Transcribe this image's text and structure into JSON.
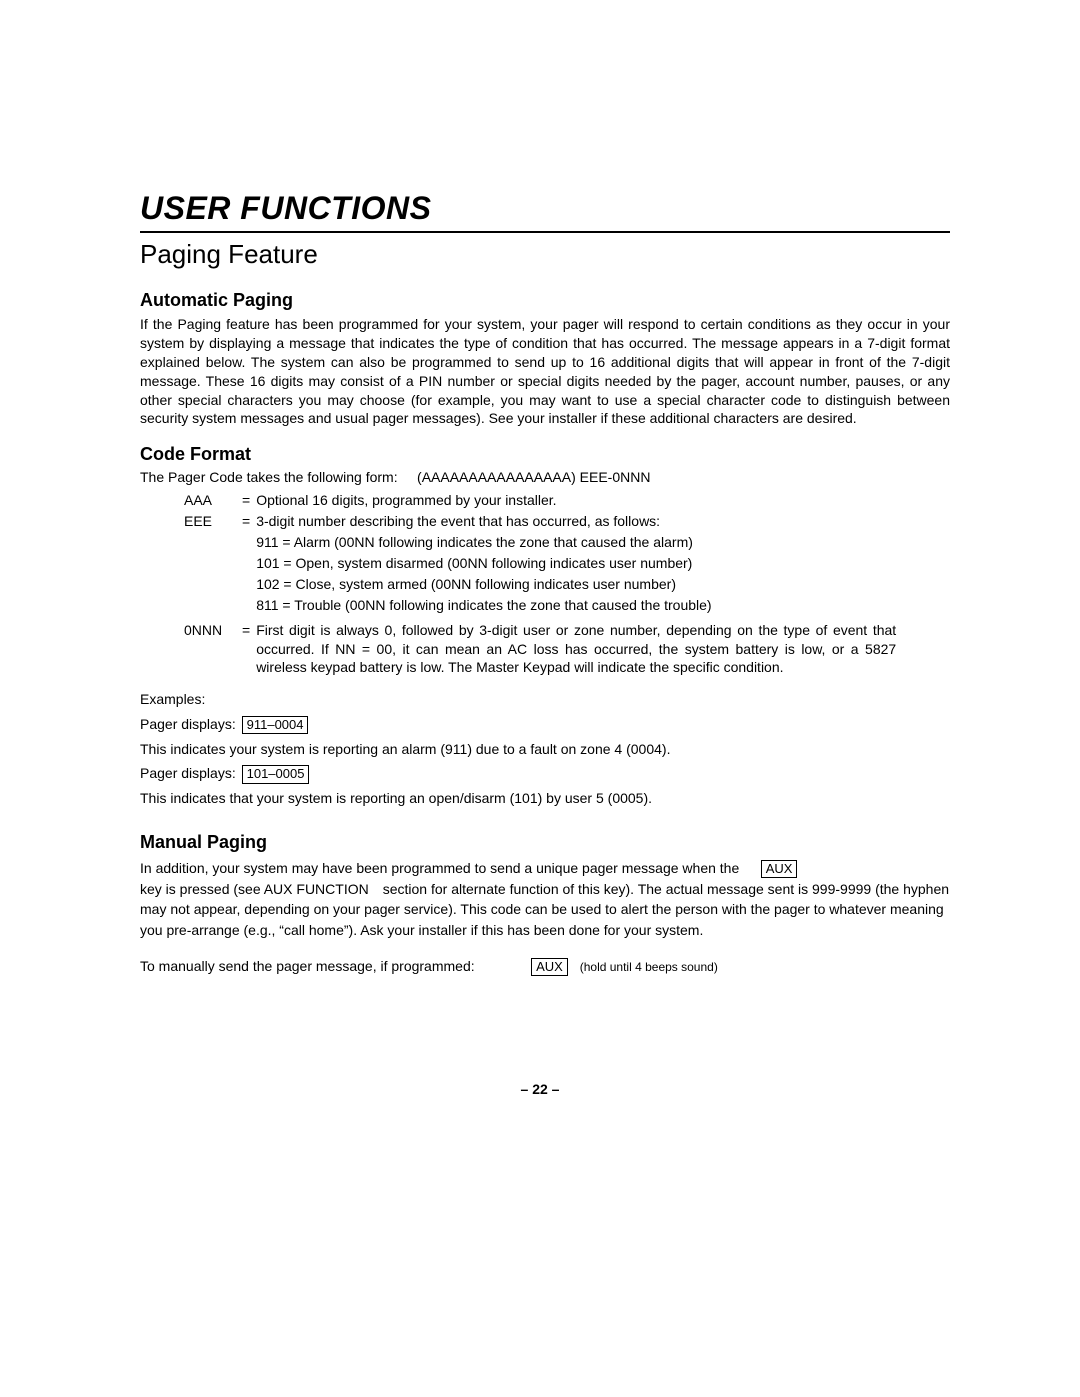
{
  "title": "USER FUNCTIONS",
  "subtitle": "Paging Feature",
  "auto": {
    "heading": "Automatic Paging",
    "body": "If the Paging feature has been programmed for your system, your pager will respond to certain conditions as they occur in your system by displaying a message that indicates the type of condition that has occurred. The message appears in a 7-digit format explained below. The system can also be programmed to send up to 16 additional digits that will appear in front of the 7-digit message. These 16 digits may consist of a PIN number or special digits needed by the pager, account number, pauses, or any other special characters you may choose (for example, you may want to use a special character code to distinguish between security system messages and usual pager messages). See your installer if these additional characters are desired."
  },
  "code": {
    "heading": "Code Format",
    "form_intro": "The Pager Code takes the following form:",
    "form_pattern": "(AAAAAAAAAAAAAAAA) EEE-0NNN",
    "aaa_label": "AAA",
    "aaa_def": "Optional 16 digits, programmed by your installer.",
    "eee_label": "EEE",
    "eee_def": "3-digit number describing the event that has occurred, as follows:",
    "eee_lines": [
      "911 = Alarm (00NN following indicates the zone that caused the alarm)",
      "101 = Open, system disarmed (00NN following indicates user number)",
      "102 = Close, system armed (00NN following indicates user number)",
      "811 = Trouble (00NN following indicates the zone that caused the trouble)"
    ],
    "nnn_label": "0NNN",
    "nnn_def": "First digit is always 0, followed by 3-digit user or zone number, depending on the type of event that occurred. If NN = 00, it can mean an AC loss has occurred, the system battery is low, or a 5827 wireless keypad battery is low. The Master Keypad will indicate the specific condition.",
    "examples_label": "Examples:",
    "pager_displays_label": "Pager displays:",
    "ex1_code": "911–0004",
    "ex1_desc": "This indicates your system is reporting an alarm (911) due to a fault on zone 4 (0004).",
    "ex2_code": "101–0005",
    "ex2_desc": "This indicates that your system is reporting an open/disarm (101) by user 5 (0005)."
  },
  "manual": {
    "heading": "Manual Paging",
    "p1_pre": "In addition, your system may have been programmed to send a unique pager message when the",
    "aux_key": "AUX",
    "p1_post": "key is pressed (see AUX FUNCTION section for alternate function of this key). The actual message sent is 999-9999 (the hyphen may not appear, depending on your pager service). This code can be used to alert the person with the pager to whatever meaning you pre-arrange (e.g., “call home”).  Ask your installer if this has been done for your system.",
    "row_intro": "To manually send the pager message, if programmed:",
    "row_hold": "(hold until 4 beeps sound)"
  },
  "page_number": "– 22 –"
}
